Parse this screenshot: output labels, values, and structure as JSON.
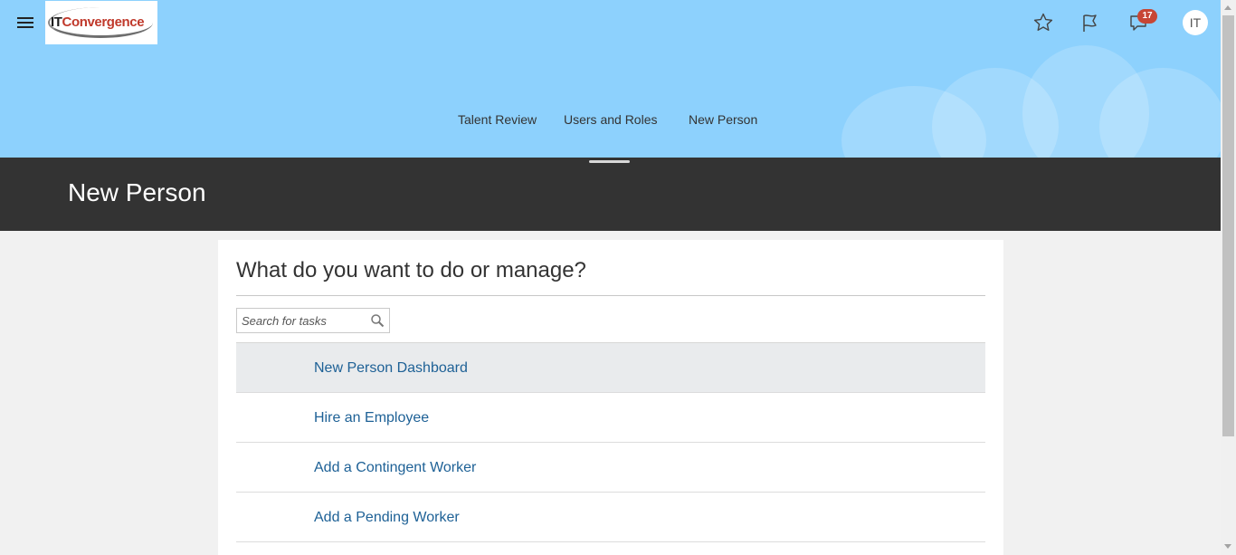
{
  "header": {
    "logo": {
      "it": "IT",
      "convergence": "Convergence",
      "alt": "ITConvergence"
    },
    "notification_count": "17",
    "user_initials": "IT",
    "icons": [
      "menu-icon",
      "favorites-star-icon",
      "watchlist-flag-icon",
      "notifications-icon"
    ],
    "nav": [
      {
        "label": "Talent Review"
      },
      {
        "label": "Users and Roles"
      },
      {
        "label": "New Person"
      }
    ]
  },
  "page": {
    "title": "New Person"
  },
  "panel": {
    "heading": "What do you want to do or manage?",
    "search": {
      "placeholder": "Search for tasks",
      "value": ""
    },
    "tasks": [
      {
        "label": "New Person Dashboard",
        "selected": true
      },
      {
        "label": "Hire an Employee"
      },
      {
        "label": "Add a Contingent Worker"
      },
      {
        "label": "Add a Pending Worker"
      }
    ]
  },
  "colors": {
    "header_bg": "#8dd1fd",
    "band_bg": "#333333",
    "link": "#1e6196",
    "badge": "#c74634",
    "selected_row": "#e9ebed"
  }
}
